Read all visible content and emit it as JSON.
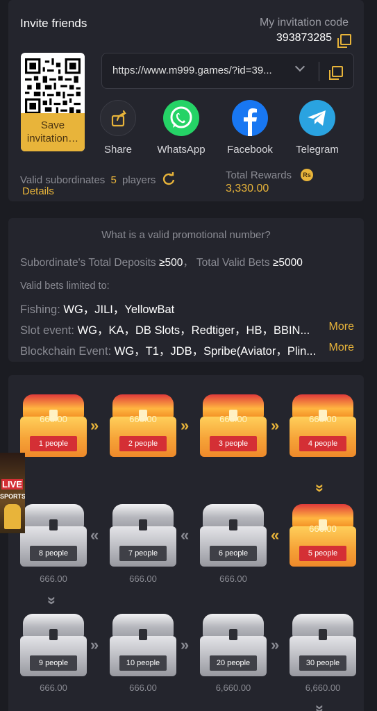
{
  "invite": {
    "title": "Invite friends",
    "code_label": "My invitation code",
    "code_value": "393873285",
    "save_label_1": "Save",
    "save_label_2": "invitation…",
    "url": "https://www.m999.games/?id=39..."
  },
  "social": [
    {
      "label": "Share",
      "icon": "share-icon",
      "color": "#2a2b33"
    },
    {
      "label": "WhatsApp",
      "icon": "whatsapp-icon",
      "color": "#25d366"
    },
    {
      "label": "Facebook",
      "icon": "facebook-icon",
      "color": "#1877f2"
    },
    {
      "label": "Telegram",
      "icon": "telegram-icon",
      "color": "#2aa3e0"
    }
  ],
  "stats": {
    "subordinates_label": "Valid subordinates",
    "subordinates_count": "5",
    "subordinates_unit": "players",
    "details": "Details",
    "rewards_label": "Total Rewards",
    "rewards_badge": "Rs",
    "rewards_value": "3,330.00"
  },
  "promo": {
    "heading": "What is a valid promotional number?",
    "deposits_label": "Subordinate's Total Deposits",
    "deposits_value": "≥500",
    "bets_label": "Total Valid Bets",
    "bets_value": "≥5000",
    "limited": "Valid bets limited to:",
    "fishing_label": "Fishing:",
    "fishing_value": "WG，JILI，YellowBat",
    "slot_label": "Slot event:",
    "slot_value": "WG，KA，DB Slots，Redtiger，HB，BBIN...",
    "block_label": "Blockchain Event:",
    "block_value": "WG，T1，JDB，Spribe(Aviator，Plin...",
    "more": "More"
  },
  "chests": [
    {
      "people": "1 people",
      "amount": "666.00",
      "opened": true
    },
    {
      "people": "2 people",
      "amount": "666.00",
      "opened": true
    },
    {
      "people": "3 people",
      "amount": "666.00",
      "opened": true
    },
    {
      "people": "4 people",
      "amount": "666.00",
      "opened": true
    },
    {
      "people": "5 people",
      "amount": "666.00",
      "opened": true
    },
    {
      "people": "6 people",
      "amount": "666.00",
      "opened": false
    },
    {
      "people": "7 people",
      "amount": "666.00",
      "opened": false
    },
    {
      "people": "8 people",
      "amount": "666.00",
      "opened": false
    },
    {
      "people": "9 people",
      "amount": "666.00",
      "opened": false
    },
    {
      "people": "10 people",
      "amount": "666.00",
      "opened": false
    },
    {
      "people": "20 people",
      "amount": "6,660.00",
      "opened": false
    },
    {
      "people": "30 people",
      "amount": "6,660.00",
      "opened": false
    }
  ],
  "live": {
    "line1": "LIVE",
    "line2": "SPORTS"
  },
  "colors": {
    "accent": "#e8b43a",
    "background": "#1b1c22",
    "card": "#24252d"
  }
}
